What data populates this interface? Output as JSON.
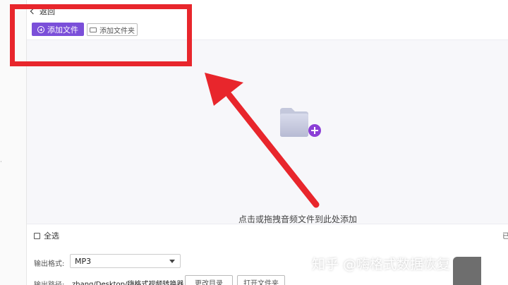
{
  "nav": {
    "back_label": "返回"
  },
  "toolbar": {
    "add_file_label": "添加文件",
    "add_folder_label": "添加文件夹"
  },
  "drop_zone": {
    "hint": "点击或拖拽音频文件到此处添加"
  },
  "select_all": {
    "label": "全选"
  },
  "edge_text": "已",
  "output": {
    "format_label": "输出格式:",
    "format_value": "MP3",
    "path_label": "输出路径:",
    "path_value": "zhang/Desktop/嗨格式视频转换器",
    "change_dir_label": "更改目录",
    "open_folder_label": "打开文件夹"
  },
  "watermark": "知乎 @嗨格式数据恢复",
  "colors": {
    "accent": "#7b4fd9",
    "annotation": "#e8262c",
    "drop_bg": "#f7f7fa"
  },
  "icons": [
    "chevron-left-icon",
    "plus-circle-icon",
    "folder-icon",
    "folder-add-icon",
    "checkbox-icon",
    "caret-down-icon"
  ]
}
